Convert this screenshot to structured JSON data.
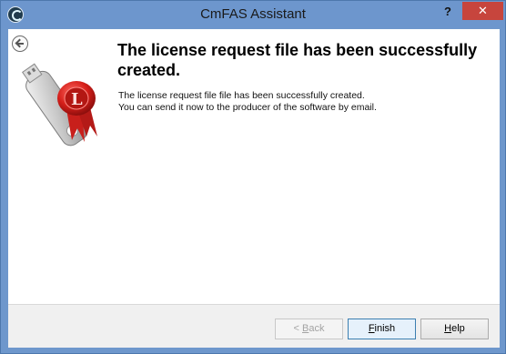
{
  "window": {
    "title": "CmFAS Assistant",
    "help_glyph": "?",
    "close_glyph": "✕"
  },
  "page": {
    "heading": "The license request file has been successfully created.",
    "line1": "The license request file file has been successfully created.",
    "line2": "You can send it now to the producer of the software by email."
  },
  "buttons": {
    "back_prefix": "< ",
    "back_accel": "B",
    "back_rest": "ack",
    "finish_accel": "F",
    "finish_rest": "inish",
    "help_accel": "H",
    "help_rest": "elp"
  },
  "icons": {
    "app": "app-logo-icon",
    "back": "back-arrow-icon",
    "graphic": "usb-license-seal-icon"
  },
  "colors": {
    "titlebar": "#6d96cd",
    "close": "#c7453d",
    "accent": "#3c7fb1"
  }
}
